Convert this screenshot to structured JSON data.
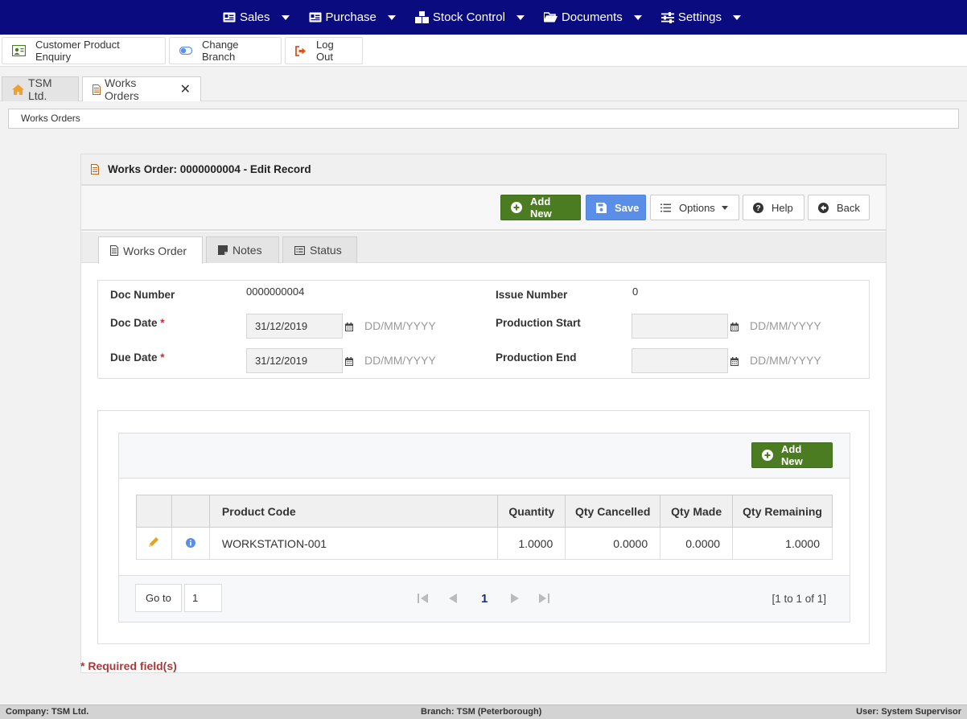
{
  "nav": {
    "items": [
      {
        "label": "Sales",
        "icon": "id-card-icon"
      },
      {
        "label": "Purchase",
        "icon": "id-card-icon"
      },
      {
        "label": "Stock Control",
        "icon": "cubes-icon"
      },
      {
        "label": "Documents",
        "icon": "folder-open-icon"
      },
      {
        "label": "Settings",
        "icon": "sliders-icon"
      }
    ],
    "color": "#0b0b80"
  },
  "toolbar": {
    "customer_enquiry": "Customer Product Enquiry",
    "change_branch": "Change Branch",
    "log_out": "Log Out"
  },
  "tabs": [
    {
      "label": "TSM Ltd.",
      "icon": "home-icon"
    },
    {
      "label": "Works Orders",
      "icon": "document-icon",
      "close": "✕"
    }
  ],
  "breadcrumb": "Works Orders",
  "panel": {
    "title": "Works Order: 0000000004 - Edit Record",
    "actions": {
      "add_new": "Add New",
      "save": "Save",
      "options": "Options",
      "help": "Help",
      "back": "Back"
    },
    "form_tabs": [
      "Works Order",
      "Notes",
      "Status"
    ]
  },
  "form": {
    "doc_number_label": "Doc Number",
    "doc_number": "0000000004",
    "issue_number_label": "Issue Number",
    "issue_number": "0",
    "doc_date_label": "Doc Date",
    "doc_date": "31/12/2019",
    "due_date_label": "Due Date",
    "due_date": "31/12/2019",
    "production_start_label": "Production Start",
    "production_start": "",
    "production_end_label": "Production End",
    "production_end": "",
    "date_format": "DD/MM/YYYY",
    "required_marker": "*"
  },
  "grid": {
    "add_new": "Add New",
    "columns": [
      "Product Code",
      "Quantity",
      "Qty Cancelled",
      "Qty Made",
      "Qty Remaining"
    ],
    "rows": [
      {
        "product_code": "WORKSTATION-001",
        "quantity": "1.0000",
        "qty_cancelled": "0.0000",
        "qty_made": "0.0000",
        "qty_remaining": "1.0000"
      }
    ],
    "pager": {
      "goto_label": "Go to",
      "goto_value": "1",
      "current_page": "1",
      "info": "[1 to 1 of 1]"
    }
  },
  "required_note": "* Required field(s)",
  "status": {
    "company": "Company: TSM Ltd.",
    "branch": "Branch: TSM (Peterborough)",
    "user": "User: System Supervisor"
  },
  "colors": {
    "nav_bg": "#0b0b80",
    "add_new_green": "#4b7c22",
    "save_blue": "#5b8ee6",
    "required_red": "#a83a3a"
  }
}
